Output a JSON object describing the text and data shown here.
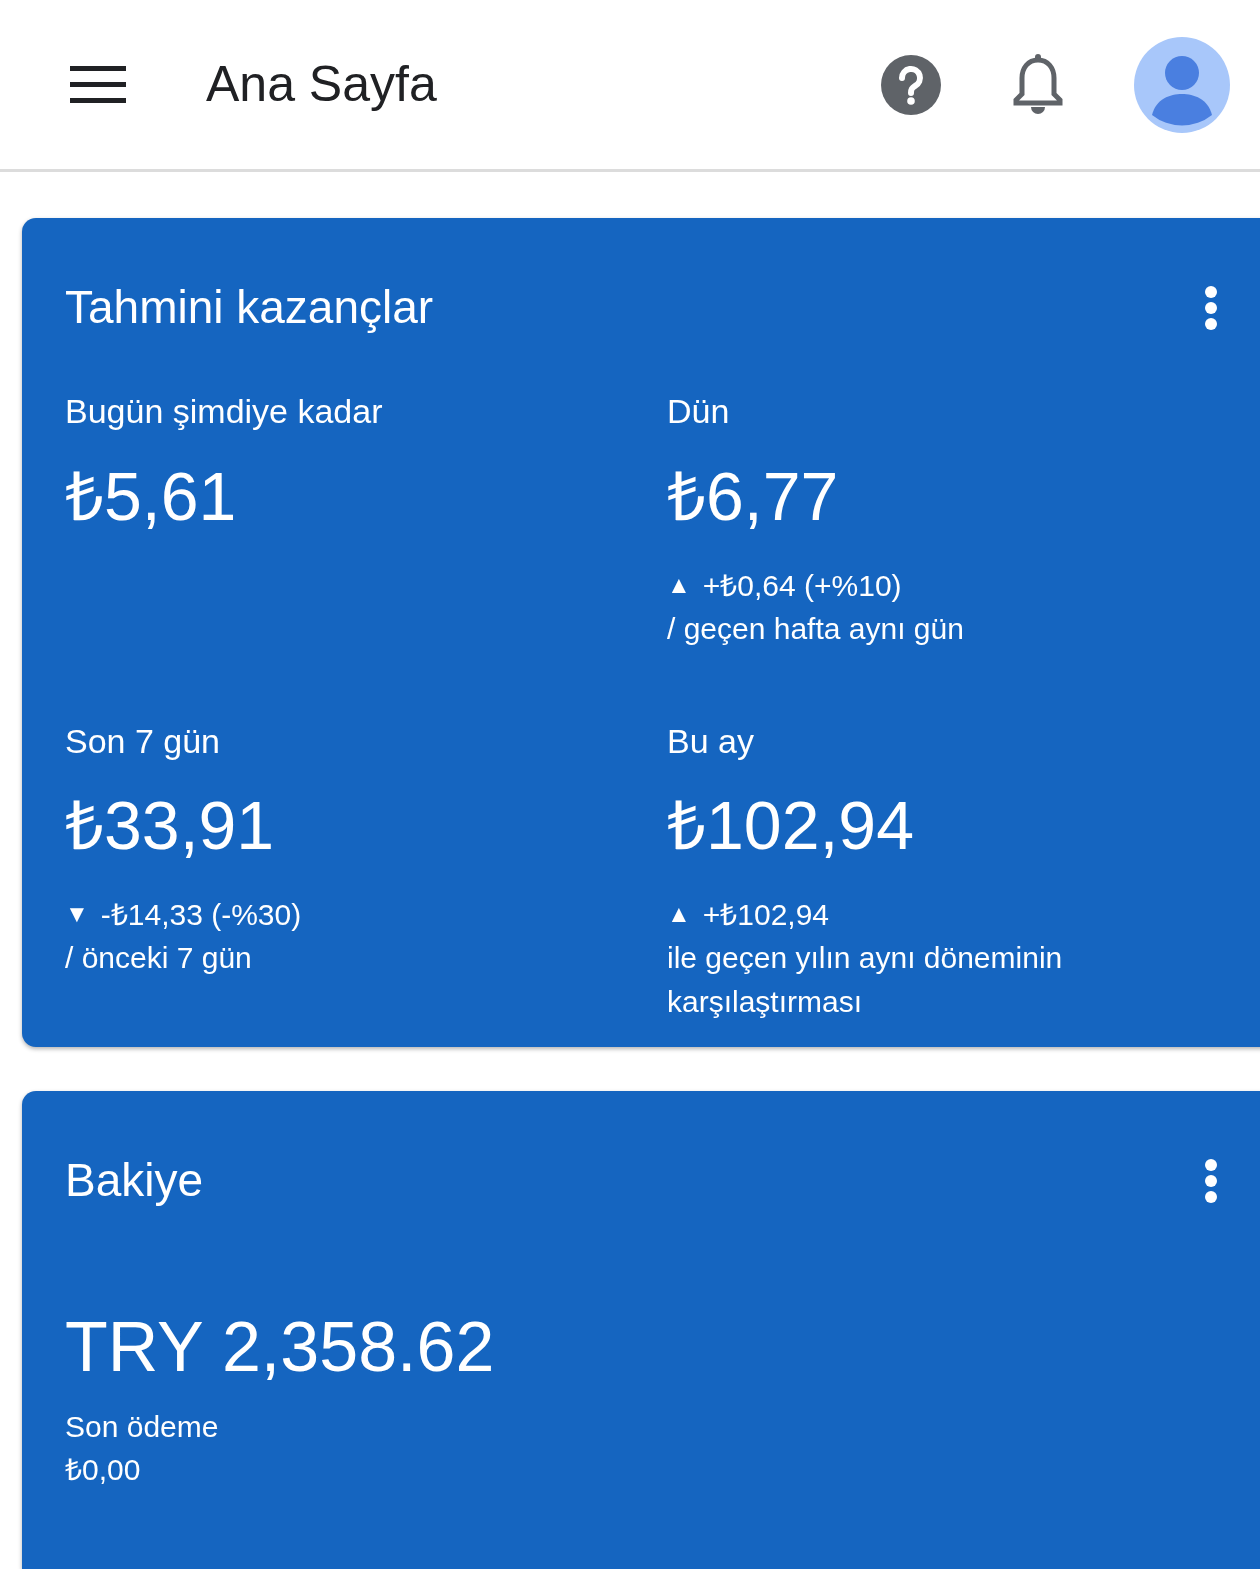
{
  "header": {
    "title": "Ana Sayfa"
  },
  "cards": [
    {
      "kind": "earnings",
      "title": "Tahmini kazançlar",
      "metrics": [
        {
          "label": "Bugün şimdiye kadar",
          "value": "₺5,61"
        },
        {
          "label": "Dün",
          "value": "₺6,77",
          "change": {
            "arrow": "▲",
            "text": "+₺0,64 (+%10)",
            "note": "/ geçen hafta aynı gün"
          }
        },
        {
          "label": "Son 7 gün",
          "value": "₺33,91",
          "change": {
            "arrow": "▼",
            "text": "-₺14,33 (-%30)",
            "note": "/ önceki 7 gün"
          }
        },
        {
          "label": "Bu ay",
          "value": "₺102,94",
          "change": {
            "arrow": "▲",
            "text": "+₺102,94",
            "note": "ile geçen yılın aynı döneminin karşılaştırması"
          }
        }
      ]
    },
    {
      "kind": "balance",
      "title": "Bakiye",
      "amount": "TRY 2,358.62",
      "payment_label": "Son ödeme",
      "payment_value": "₺0,00"
    }
  ]
}
